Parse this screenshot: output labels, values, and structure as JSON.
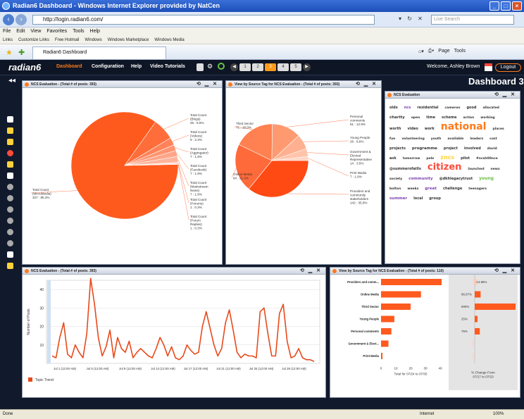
{
  "window": {
    "title": "Radian6 Dashboard - Windows Internet Explorer provided by NatCen"
  },
  "browser": {
    "url": "http://login.radian6.com/",
    "search_placeholder": "Live Search",
    "menu": [
      "File",
      "Edit",
      "View",
      "Favorites",
      "Tools",
      "Help"
    ],
    "links": [
      "Links",
      "Customize Links",
      "Free Hotmail",
      "Windows",
      "Windows Marketplace",
      "Windows Media"
    ],
    "tab": "Radian6 Dashboard",
    "tools": [
      "Page",
      "Tools"
    ]
  },
  "app": {
    "logo": "radian6",
    "nav": [
      "Dashboard",
      "Configuration",
      "Help",
      "Video Tutorials"
    ],
    "pages": [
      "1",
      "2",
      "3",
      "4",
      "5"
    ],
    "selected_page": "3",
    "welcome": "Welcome, Ashley Brown",
    "logout": "Logout",
    "dashboard_title": "Dashboard 3"
  },
  "w1": {
    "title": "NCS Evaluation - (Total # of posts: 393)"
  },
  "w2": {
    "title": "View by Source Tag for NCS Evaluation - (Total # of posts: 393)"
  },
  "w3": {
    "title": "NCS Evaluation"
  },
  "w4": {
    "title": "NCS Evaluation - (Total # of posts: 393)",
    "legend": "Topic Trend"
  },
  "w5": {
    "title": "View by Source Tag for NCS Evaluation - (Total # of posts: 110)",
    "xaxis": "Total for 07/24 to 07/30",
    "change_label": "% Change From",
    "change_range": "07/17 to 07/23"
  },
  "chart_data": [
    {
      "type": "pie",
      "slices": [
        {
          "label": "Total Count (MicroMedia)",
          "count": "337",
          "pct": "85.3%",
          "color": "#ff5a1e",
          "value": 85.3
        },
        {
          "label": "Total Count (Blogs)",
          "count": "26",
          "pct": "6.6%",
          "color": "#ff6e3a",
          "value": 6.6
        },
        {
          "label": "Total Count (Videos)",
          "count": "9",
          "pct": "2.3%",
          "color": "#ff8258",
          "value": 2.3
        },
        {
          "label": "Total Count (Aggregator)",
          "count": "7",
          "pct": "1.8%",
          "color": "#ff9470",
          "value": 1.8
        },
        {
          "label": "Total Count (Facebook)",
          "count": "7",
          "pct": "1.8%",
          "color": "#ffa588",
          "value": 1.8
        },
        {
          "label": "Total Count (Mainstream News)",
          "count": "7",
          "pct": "1.8%",
          "color": "#ffb49c",
          "value": 1.8
        },
        {
          "label": "Total Count (Forums)",
          "count": "1",
          "pct": "0.3%",
          "color": "#ffc4b0",
          "value": 0.3
        },
        {
          "label": "Total Count (Forum Replies)",
          "count": "1",
          "pct": "0.3%",
          "color": "#ffd2c2",
          "value": 0.3
        }
      ]
    },
    {
      "type": "pie",
      "slices": [
        {
          "label": "Providers and community stakeholders",
          "count": "142",
          "pct": "35.9%",
          "color": "#ff4a14",
          "value": 35.9
        },
        {
          "label": "Online Media",
          "count": "84",
          "pct": "21.3%",
          "color": "#ff6a3a",
          "value": 21.3
        },
        {
          "label": "Third Sector",
          "count": "71",
          "pct": "18.0%",
          "color": "#ff8050",
          "value": 18.0
        },
        {
          "label": "Personal comments",
          "count": "51",
          "pct": "12.9%",
          "color": "#ff9a70",
          "value": 12.9
        },
        {
          "label": "Young People",
          "count": "26",
          "pct": "6.6%",
          "color": "#ffb090",
          "value": 6.6
        },
        {
          "label": "Government & Elected Representative",
          "count": "14",
          "pct": "3.5%",
          "color": "#ffc4aa",
          "value": 3.5
        },
        {
          "label": "Print Media",
          "count": "7",
          "pct": "1.8%",
          "color": "#ffd6c4",
          "value": 1.8
        }
      ]
    },
    {
      "type": "line",
      "yaxis_label": "Number of Posts",
      "ylim": [
        0,
        45
      ],
      "yticks": [
        10,
        20,
        30,
        40
      ],
      "xticks": [
        "Jul 1 (12:00 AM)",
        "Jul 5 (12:00 AM)",
        "Jul 9 (12:00 AM)",
        "Jul 13 (12:00 AM)",
        "Jul 17 (12:00 AM)",
        "Jul 21 (12:00 AM)",
        "Jul 25 (12:00 AM)",
        "Jul 29 (12:00 AM)"
      ],
      "series": [
        {
          "name": "Topic Trend",
          "color": "#e8491a",
          "values": [
            4,
            3,
            14,
            22,
            5,
            3,
            10,
            6,
            3,
            16,
            46,
            32,
            14,
            4,
            9,
            18,
            3,
            14,
            8,
            6,
            12,
            3,
            6,
            8,
            6,
            4,
            3,
            8,
            14,
            10,
            4,
            9,
            3,
            2,
            4,
            10,
            7,
            5,
            6,
            20,
            28,
            19,
            10,
            4,
            8,
            22,
            29,
            18,
            6,
            3,
            5,
            4,
            4,
            3,
            28,
            30,
            16,
            4,
            4,
            27,
            32,
            12,
            3,
            4,
            8,
            3,
            2,
            2,
            1
          ]
        }
      ]
    },
    {
      "type": "bar",
      "orientation": "horizontal",
      "categories": [
        "Providers and comm...",
        "Online Media",
        "Third Sector",
        "Young People",
        "Personal comments",
        "Government & Elect...",
        "Print Media"
      ],
      "values": [
        41,
        27,
        20,
        9,
        7,
        5,
        1
      ],
      "xlim": [
        0,
        40
      ],
      "xticks": [
        0,
        10,
        20,
        30,
        40
      ],
      "change_labels": [
        "-14.89%",
        "86.67%",
        "600%",
        "25%",
        "75%",
        "",
        ""
      ],
      "change_values": [
        -14.89,
        86.67,
        600,
        25,
        75,
        -50,
        -40
      ]
    }
  ],
  "word_cloud": [
    [
      "olds",
      "#333",
      5
    ],
    [
      "ncs",
      "#7d3fb0",
      5
    ],
    [
      "residential",
      "#333",
      5
    ],
    [
      "cameron",
      "#333",
      4.5
    ],
    [
      "good",
      "#333",
      5
    ],
    [
      "allocated",
      "#333",
      4.5
    ],
    [
      "charity",
      "#333",
      5.5
    ],
    [
      "open",
      "#333",
      4.5
    ],
    [
      "time",
      "#333",
      5
    ],
    [
      "scheme",
      "#333",
      5
    ],
    [
      "action",
      "#333",
      4.5
    ],
    [
      "working",
      "#333",
      4.5
    ],
    [
      "worth",
      "#333",
      5
    ],
    [
      "video",
      "#333",
      5
    ],
    [
      "work",
      "#333",
      5
    ],
    [
      "national",
      "#ff7a1a",
      14
    ],
    [
      "places",
      "#333",
      4.5
    ],
    [
      "fun",
      "#333",
      4.5
    ],
    [
      "volunteering",
      "#333",
      4.5
    ],
    [
      "youth",
      "#333",
      4.5
    ],
    [
      "available",
      "#333",
      4.5
    ],
    [
      "leaders",
      "#333",
      4.5
    ],
    [
      "cost",
      "#333",
      4.5
    ],
    [
      "projects",
      "#333",
      5
    ],
    [
      "programme",
      "#333",
      5.5
    ],
    [
      "project",
      "#333",
      5
    ],
    [
      "involved",
      "#333",
      5
    ],
    [
      "david",
      "#333",
      4.5
    ],
    [
      "ask",
      "#333",
      5
    ],
    [
      "tomorrow",
      "#333",
      4.5
    ],
    [
      "pele",
      "#333",
      4.5
    ],
    [
      "zncs",
      "#ffd23a",
      8
    ],
    [
      "pilot",
      "#333",
      5
    ],
    [
      "#ncsh00nce",
      "#333",
      4.5
    ],
    [
      "@summerofaills",
      "#333",
      5
    ],
    [
      "citizen",
      "#ff4a3a",
      13
    ],
    [
      "launched",
      "#333",
      4.5
    ],
    [
      "news",
      "#333",
      4.5
    ],
    [
      "society",
      "#333",
      4.5
    ],
    [
      "community",
      "#7d3fb0",
      5.5
    ],
    [
      "@dkhlegacytrust",
      "#333",
      5
    ],
    [
      "young",
      "#6ac046",
      6
    ],
    [
      "bolton",
      "#333",
      4.5
    ],
    [
      "weeks",
      "#333",
      4.5
    ],
    [
      "great",
      "#7d3fb0",
      5.5
    ],
    [
      "challenge",
      "#333",
      5
    ],
    [
      "teenagers",
      "#333",
      4.5
    ],
    [
      "summer",
      "#7d3fb0",
      5.5
    ],
    [
      "local",
      "#333",
      5
    ],
    [
      "group",
      "#333",
      5
    ]
  ],
  "status": {
    "left": "Done",
    "zone": "Internet",
    "zoom": "100%"
  }
}
